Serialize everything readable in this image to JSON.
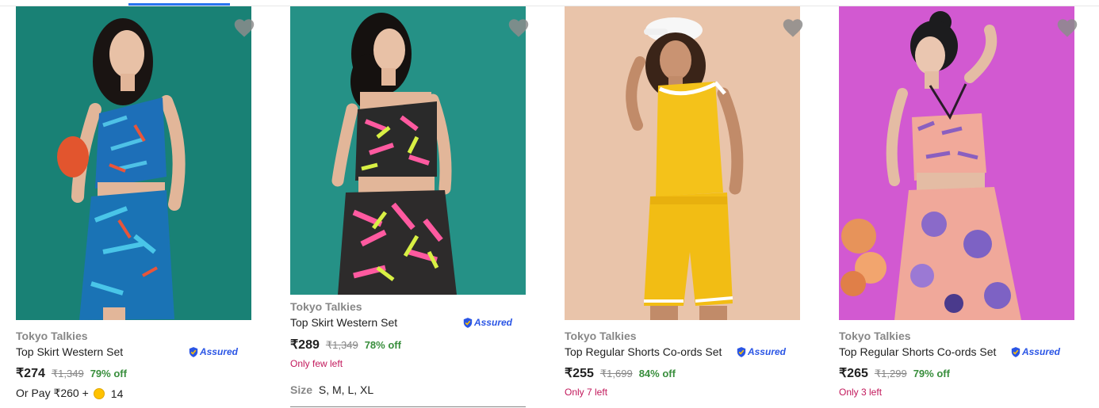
{
  "products": [
    {
      "brand": "Tokyo Talkies",
      "title": "Top Skirt Western Set",
      "assured_label": "Assured",
      "price": "₹274",
      "mrp": "₹1,349",
      "discount": "79% off",
      "pay_prefix": "Or Pay ₹260 +",
      "coins": "14",
      "image_icon": "woman-in-blue-floral-skirt-set",
      "bg_color": "#1e8c7f"
    },
    {
      "brand": "Tokyo Talkies",
      "title": "Top Skirt Western Set",
      "assured_label": "Assured",
      "price": "₹289",
      "mrp": "₹1,349",
      "discount": "78% off",
      "stock": "Only few left",
      "size_label": "Size",
      "sizes": "S, M, L, XL",
      "image_icon": "woman-in-pink-yellow-floral-skirt-set",
      "bg_color": "#2b9c8f"
    },
    {
      "brand": "Tokyo Talkies",
      "title": "Top Regular Shorts Co-ords Set",
      "assured_label": "Assured",
      "price": "₹255",
      "mrp": "₹1,699",
      "discount": "84% off",
      "stock": "Only 7 left",
      "image_icon": "woman-in-yellow-shorts-set",
      "bg_color": "#e9c4aa"
    },
    {
      "brand": "Tokyo Talkies",
      "title": "Top Regular Shorts Co-ords Set",
      "assured_label": "Assured",
      "price": "₹265",
      "mrp": "₹1,299",
      "discount": "79% off",
      "stock": "Only 3 left",
      "image_icon": "woman-in-peach-floral-shorts-set",
      "bg_color": "#d85fd6"
    }
  ],
  "colors": {
    "discount": "#388e3c",
    "stock": "#c2185b",
    "brand": "#878787",
    "assured": "#2a55e5",
    "accent": "#2874f0"
  }
}
